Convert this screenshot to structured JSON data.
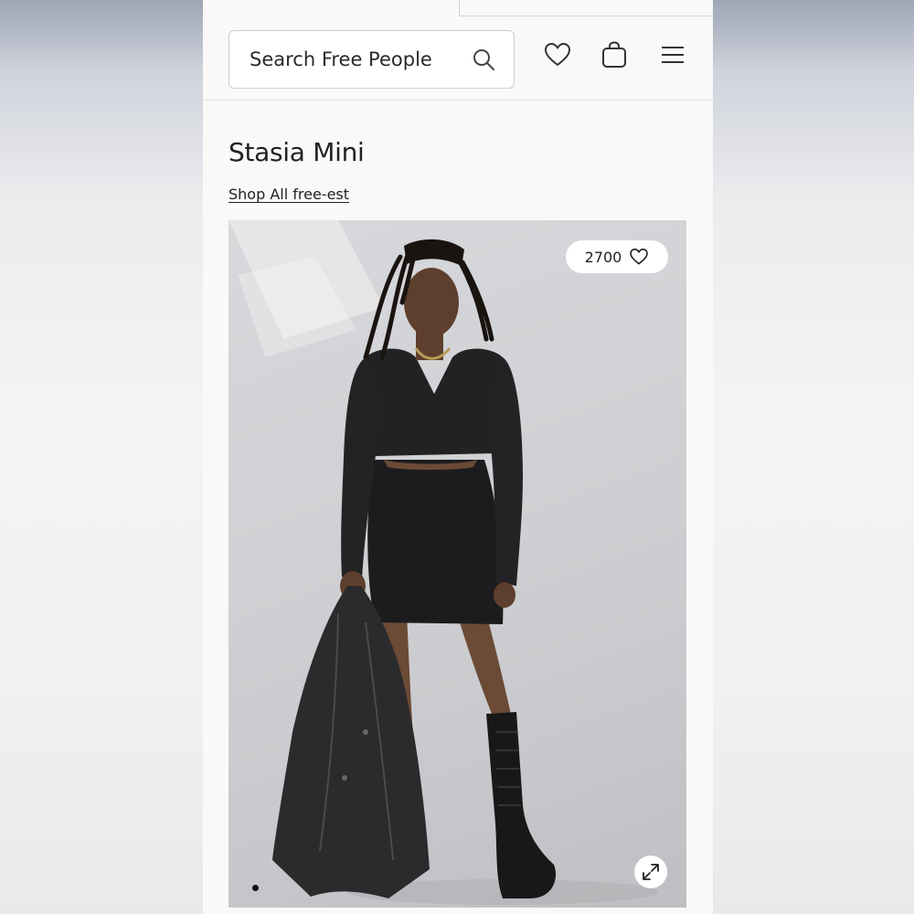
{
  "search": {
    "placeholder": "Search Free People"
  },
  "header_icons": [
    "search-icon",
    "heart-icon",
    "shopping-bag-icon",
    "hamburger-menu-icon"
  ],
  "product": {
    "title": "Stasia Mini",
    "shop_link": "Shop All free-est",
    "likes": "2700",
    "image_alt": "Stasia Mini",
    "carousel": {
      "current": 1
    }
  },
  "colors": {
    "page_bg": "#fbf9f7",
    "text": "#222222",
    "border": "#cfcdca"
  }
}
